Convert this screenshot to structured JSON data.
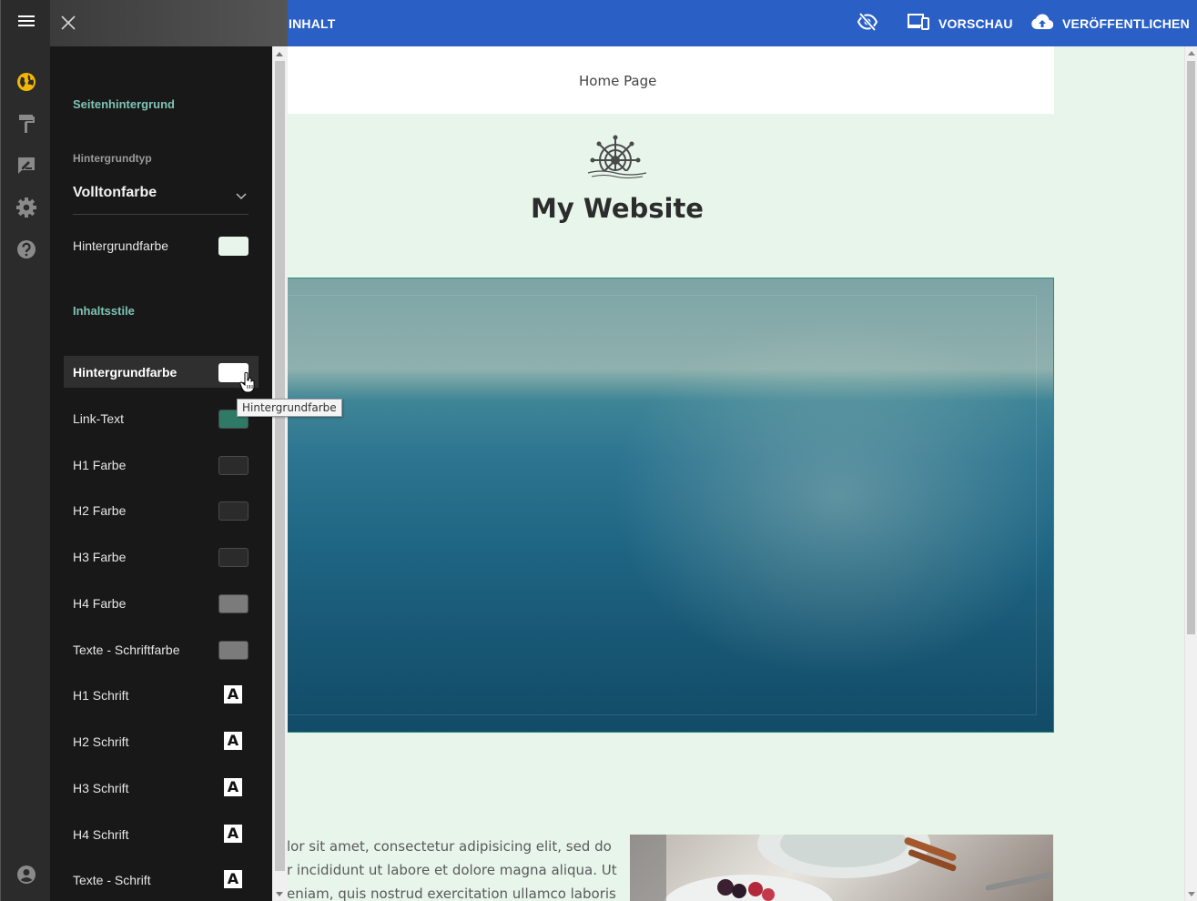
{
  "topbar": {
    "content_label": "INHALT",
    "preview_label": "VORSCHAU",
    "publish_label": "VERÖFFENTLICHEN"
  },
  "site": {
    "nav_home": "Home Page",
    "title": "My Website",
    "body_lines": [
      "lor sit amet, consectetur adipisicing elit, sed do",
      "r incididunt ut labore et dolore magna aliqua. Ut",
      "eniam, quis nostrud exercitation ullamco laboris"
    ]
  },
  "panel": {
    "page_background_title": "Seitenhintergrund",
    "background_type_label": "Hintergrundtyp",
    "background_type_value": "Volltonfarbe",
    "background_color_label": "Hintergrundfarbe",
    "background_color": "#e7f5ea",
    "content_styles_title": "Inhaltsstile",
    "style_rows": [
      {
        "label": "Hintergrundfarbe",
        "kind": "color",
        "color": "#ffffff"
      },
      {
        "label": "Link-Text",
        "kind": "color",
        "color": "#2f7a66"
      },
      {
        "label": "H1 Farbe",
        "kind": "color",
        "color": "#2b2b2b"
      },
      {
        "label": "H2 Farbe",
        "kind": "color",
        "color": "#2b2b2b"
      },
      {
        "label": "H3 Farbe",
        "kind": "color",
        "color": "#2b2b2b"
      },
      {
        "label": "H4 Farbe",
        "kind": "color",
        "color": "#7b7b7b"
      },
      {
        "label": "Texte - Schriftfarbe",
        "kind": "color",
        "color": "#7b7b7b"
      },
      {
        "label": "H1 Schrift",
        "kind": "font",
        "glyph": "A"
      },
      {
        "label": "H2 Schrift",
        "kind": "font",
        "glyph": "A"
      },
      {
        "label": "H3 Schrift",
        "kind": "font",
        "glyph": "A"
      },
      {
        "label": "H4 Schrift",
        "kind": "font",
        "glyph": "A"
      },
      {
        "label": "Texte - Schrift",
        "kind": "font",
        "glyph": "A"
      }
    ],
    "tooltip": "Hintergrundfarbe"
  },
  "rail_icons": [
    "globe-icon",
    "paint-roller-icon",
    "edit-note-icon",
    "gear-icon",
    "help-icon",
    "account-icon"
  ],
  "colors": {
    "accent_blue": "#2a60c6",
    "section_teal": "#7fc3b4",
    "active_globe": "#f2b705"
  }
}
